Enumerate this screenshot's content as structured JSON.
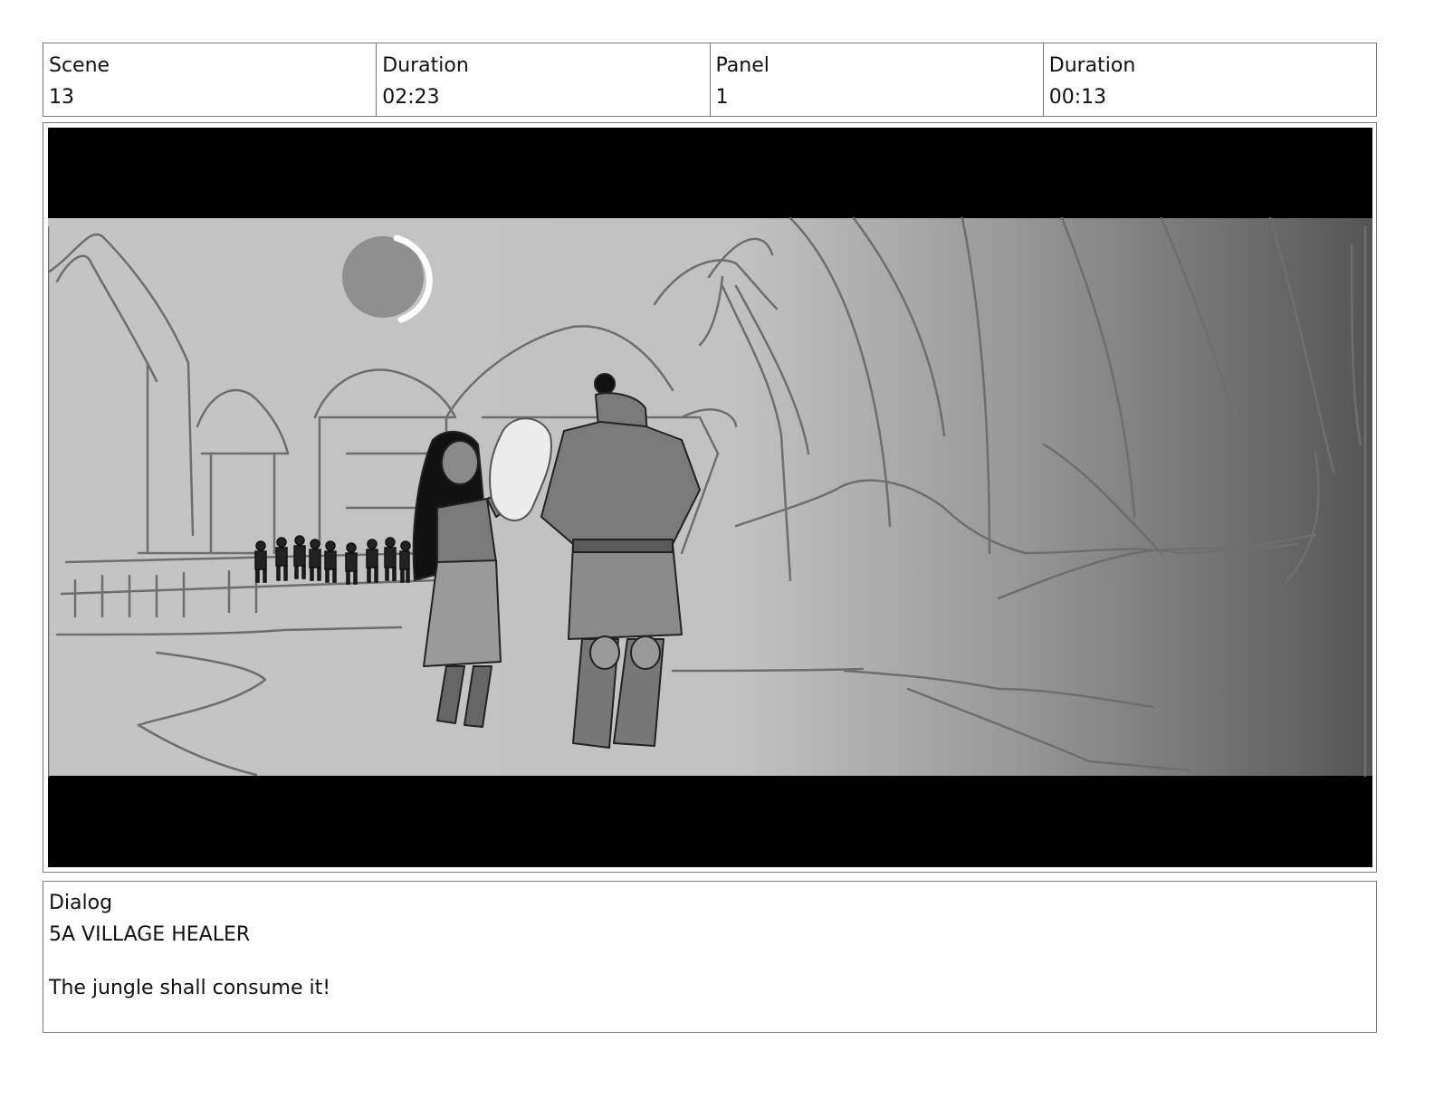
{
  "header": {
    "scene_label": "Scene",
    "scene_value": "13",
    "scene_duration_label": "Duration",
    "scene_duration_value": "02:23",
    "panel_label": "Panel",
    "panel_value": "1",
    "panel_duration_label": "Duration",
    "panel_duration_value": "00:13"
  },
  "panel": {
    "colors": {
      "letterbox": "#000000",
      "sky": "#c4c4c4",
      "shadow": "#555555",
      "line": "#6e6e6e",
      "moon": "#8f8f8f"
    }
  },
  "dialog": {
    "label": "Dialog",
    "speaker": "5A VILLAGE HEALER",
    "line": "The jungle shall consume it!"
  }
}
